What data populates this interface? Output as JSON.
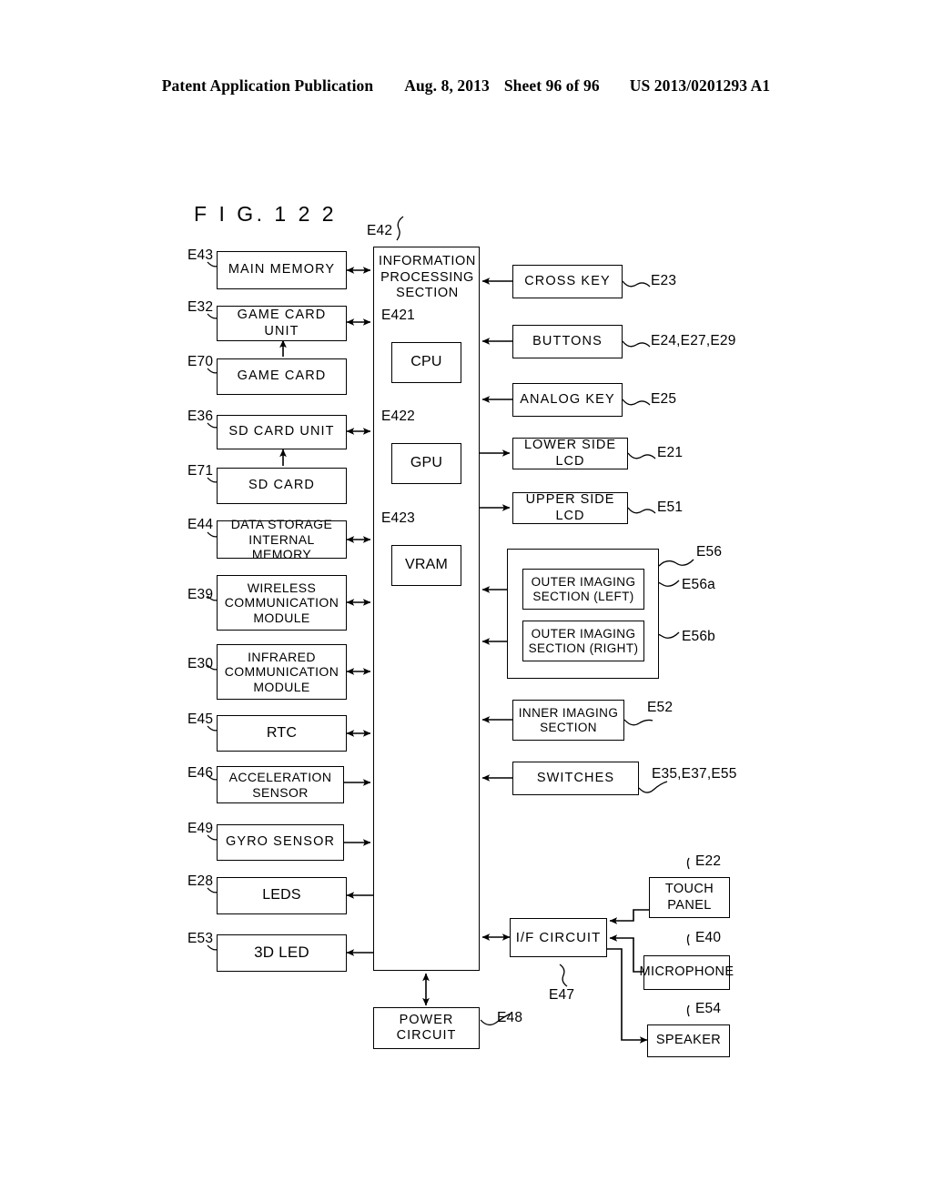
{
  "header": {
    "publication": "Patent Application Publication",
    "date": "Aug. 8, 2013",
    "sheet": "Sheet 96 of 96",
    "patent_number": "US 2013/0201293 A1"
  },
  "figure": {
    "label": "F I G.  1 2 2"
  },
  "blocks": {
    "main_memory": "MAIN MEMORY",
    "game_card_unit": "GAME CARD UNIT",
    "game_card": "GAME CARD",
    "sd_card_unit": "SD CARD UNIT",
    "sd_card": "SD CARD",
    "data_storage_internal_memory": "DATA STORAGE\nINTERNAL MEMORY",
    "wireless_communication_module": "WIRELESS\nCOMMUNICATION\nMODULE",
    "infrared_communication_module": "INFRARED\nCOMMUNICATION\nMODULE",
    "rtc": "RTC",
    "acceleration_sensor": "ACCELERATION\nSENSOR",
    "gyro_sensor": "GYRO SENSOR",
    "leds": "LEDS",
    "led_3d": "3D LED",
    "information_processing_section": "INFORMATION\nPROCESSING\nSECTION",
    "cpu": "CPU",
    "gpu": "GPU",
    "vram": "VRAM",
    "cross_key": "CROSS KEY",
    "buttons": "BUTTONS",
    "analog_key": "ANALOG KEY",
    "lower_side_lcd": "LOWER SIDE LCD",
    "upper_side_lcd": "UPPER SIDE LCD",
    "outer_imaging_left": "OUTER IMAGING\nSECTION (LEFT)",
    "outer_imaging_right": "OUTER IMAGING\nSECTION (RIGHT)",
    "inner_imaging_section": "INNER IMAGING\nSECTION",
    "switches": "SWITCHES",
    "if_circuit": "I/F CIRCUIT",
    "touch_panel": "TOUCH\nPANEL",
    "microphone": "MICROPHONE",
    "speaker": "SPEAKER",
    "power_circuit": "POWER\nCIRCUIT"
  },
  "refs": {
    "main_memory": "E43",
    "game_card_unit": "E32",
    "game_card": "E70",
    "sd_card_unit": "E36",
    "sd_card": "E71",
    "data_storage_internal_memory": "E44",
    "wireless_communication_module": "E39",
    "infrared_communication_module": "E30",
    "rtc": "E45",
    "acceleration_sensor": "E46",
    "gyro_sensor": "E49",
    "leds": "E28",
    "led_3d": "E53",
    "information_processing_section": "E42",
    "cpu": "E421",
    "gpu": "E422",
    "vram": "E423",
    "cross_key": "E23",
    "buttons": "E24,E27,E29",
    "analog_key": "E25",
    "lower_side_lcd": "E21",
    "upper_side_lcd": "E51",
    "outer_imaging_group": "E56",
    "outer_imaging_left": "E56a",
    "outer_imaging_right": "E56b",
    "inner_imaging_section": "E52",
    "switches": "E35,E37,E55",
    "if_circuit": "E47",
    "touch_panel": "E22",
    "microphone": "E40",
    "speaker": "E54",
    "power_circuit": "E48"
  }
}
